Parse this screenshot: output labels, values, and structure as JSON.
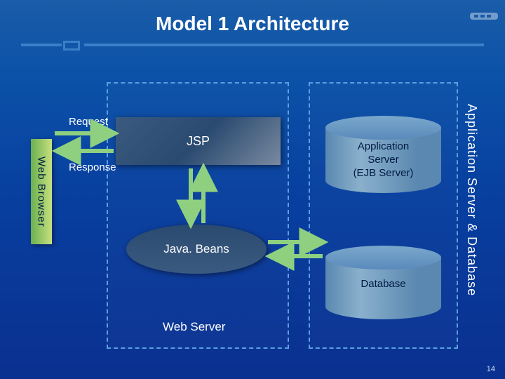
{
  "title": "Model 1 Architecture",
  "labels": {
    "web_browser": "Web Browser",
    "request": "Request",
    "response": "Response",
    "jsp": "JSP",
    "javabeans": "Java. Beans",
    "web_server": "Web Server",
    "app_server_db": "Application Server & Database"
  },
  "components": {
    "app_server": {
      "line1": "Application",
      "line2": "Server",
      "line3": "(EJB Server)"
    },
    "database": "Database"
  },
  "page_number": "14"
}
